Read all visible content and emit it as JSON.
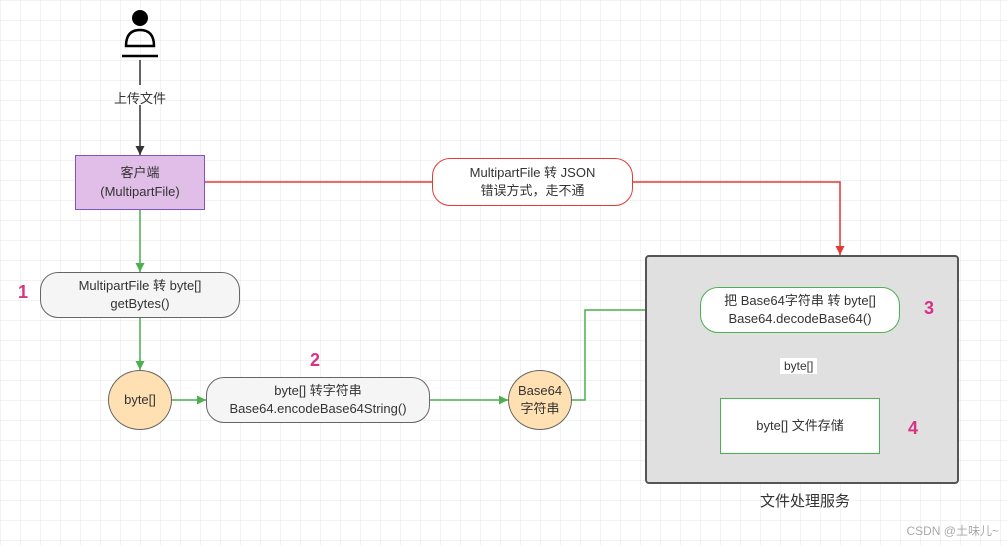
{
  "actor": {
    "label": "上传文件"
  },
  "client": {
    "line1": "客户端",
    "line2": "(MultipartFile)"
  },
  "json_error": {
    "line1": "MultipartFile 转 JSON",
    "line2": "错误方式，走不通"
  },
  "step1": {
    "num": "1",
    "line1": "MultipartFile 转   byte[]",
    "line2": "getBytes()"
  },
  "byte_node": {
    "label": "byte[]"
  },
  "step2": {
    "num": "2",
    "line1": "byte[] 转字符串",
    "line2": "Base64.encodeBase64String()"
  },
  "base64_node": {
    "line1": "Base64",
    "line2": "字符串"
  },
  "step3": {
    "num": "3",
    "line1": "把 Base64字符串 转 byte[]",
    "line2": "Base64.decodeBase64()"
  },
  "byte_label": {
    "label": "byte[]"
  },
  "step4": {
    "num": "4",
    "line1": "byte[] 文件存储"
  },
  "service": {
    "label": "文件处理服务"
  },
  "watermark": "CSDN @土味儿~"
}
